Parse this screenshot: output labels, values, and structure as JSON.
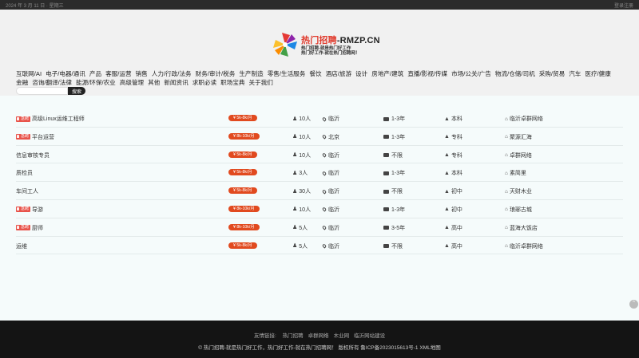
{
  "topbar": {
    "date": "2024 年 3 月 11 日 · 星期三",
    "right": "登录注册"
  },
  "logo": {
    "title_cn": "热门招聘",
    "title_en": "-RMZP.CN",
    "slogan1": "热门招聘-就是热门好工作",
    "slogan2": "热门好工作-就在热门招聘网！"
  },
  "nav": {
    "items": [
      "互联网/AI",
      "电子/电器/通讯",
      "产品",
      "客服/运营",
      "销售",
      "人力/行政/法务",
      "财务/审计/税务",
      "生产制造",
      "零售/生活服务",
      "餐饮",
      "酒店/旅游",
      "设计",
      "房地产/建筑",
      "直播/影视/传媒",
      "市场/公关/广告",
      "物流/仓储/司机",
      "采购/贸易",
      "汽车",
      "医疗/健康",
      "金融",
      "咨询/翻译/法律",
      "能源/环保/农业",
      "高级管理",
      "其他",
      "新闻资讯",
      "求职必读",
      "职场宝典",
      "关于我们"
    ]
  },
  "search": {
    "placeholder": "",
    "button": "搜索"
  },
  "urgent_label": "急聘",
  "jobs": [
    {
      "title": "高级Linux运维工程师",
      "urgent": true,
      "salary": "¥ 5k-8k/月",
      "headcount": "10人",
      "city": "临沂",
      "experience": "1-3年",
      "education": "本科",
      "company": "临沂卓群网络"
    },
    {
      "title": "平台运营",
      "urgent": true,
      "salary": "¥ 8k-10k/月",
      "headcount": "10人",
      "city": "北京",
      "experience": "1-3年",
      "education": "专科",
      "company": "聚源汇海"
    },
    {
      "title": "信息审核专员",
      "urgent": false,
      "salary": "¥ 5k-8k/月",
      "headcount": "10人",
      "city": "临沂",
      "experience": "不限",
      "education": "专科",
      "company": "卓群网络"
    },
    {
      "title": "质检员",
      "urgent": false,
      "salary": "¥ 5k-8k/月",
      "headcount": "3人",
      "city": "临沂",
      "experience": "1-3年",
      "education": "本科",
      "company": "素简里"
    },
    {
      "title": "车间工人",
      "urgent": false,
      "salary": "¥ 5k-8k/月",
      "headcount": "30人",
      "city": "临沂",
      "experience": "不限",
      "education": "初中",
      "company": "天财木业"
    },
    {
      "title": "导游",
      "urgent": true,
      "salary": "¥ 8k-10k/月",
      "headcount": "10人",
      "city": "临沂",
      "experience": "1-3年",
      "education": "初中",
      "company": "琅琊古城"
    },
    {
      "title": "厨师",
      "urgent": true,
      "salary": "¥ 8k-10k/月",
      "headcount": "5人",
      "city": "临沂",
      "experience": "3-5年",
      "education": "高中",
      "company": "蓝海大饭店"
    },
    {
      "title": "运维",
      "urgent": false,
      "salary": "¥ 5k-8k/月",
      "headcount": "5人",
      "city": "临沂",
      "experience": "不限",
      "education": "高中",
      "company": "临沂卓群网络"
    }
  ],
  "footer": {
    "friend_label": "友情链接:",
    "friend_links": [
      "热门招聘",
      "卓群网络",
      "木业网",
      "临沂网站建设"
    ],
    "copyright": "© 热门招聘-就是热门好工作，热门好工作-就在热门招聘网！ 版权所有 鲁ICP备2023015613号-1 XML地图"
  },
  "colors": {
    "salary_bg": "#e14a1f",
    "urgent_bg": "#e8534a",
    "footer_bg": "#141414",
    "accent_red": "#e0392b"
  },
  "icons": {
    "headcount": "users-icon",
    "city": "map-pin-icon",
    "experience": "id-card-icon",
    "education": "graduation-cap-icon",
    "company": "bank-icon",
    "totop": "arrow-up-icon"
  }
}
